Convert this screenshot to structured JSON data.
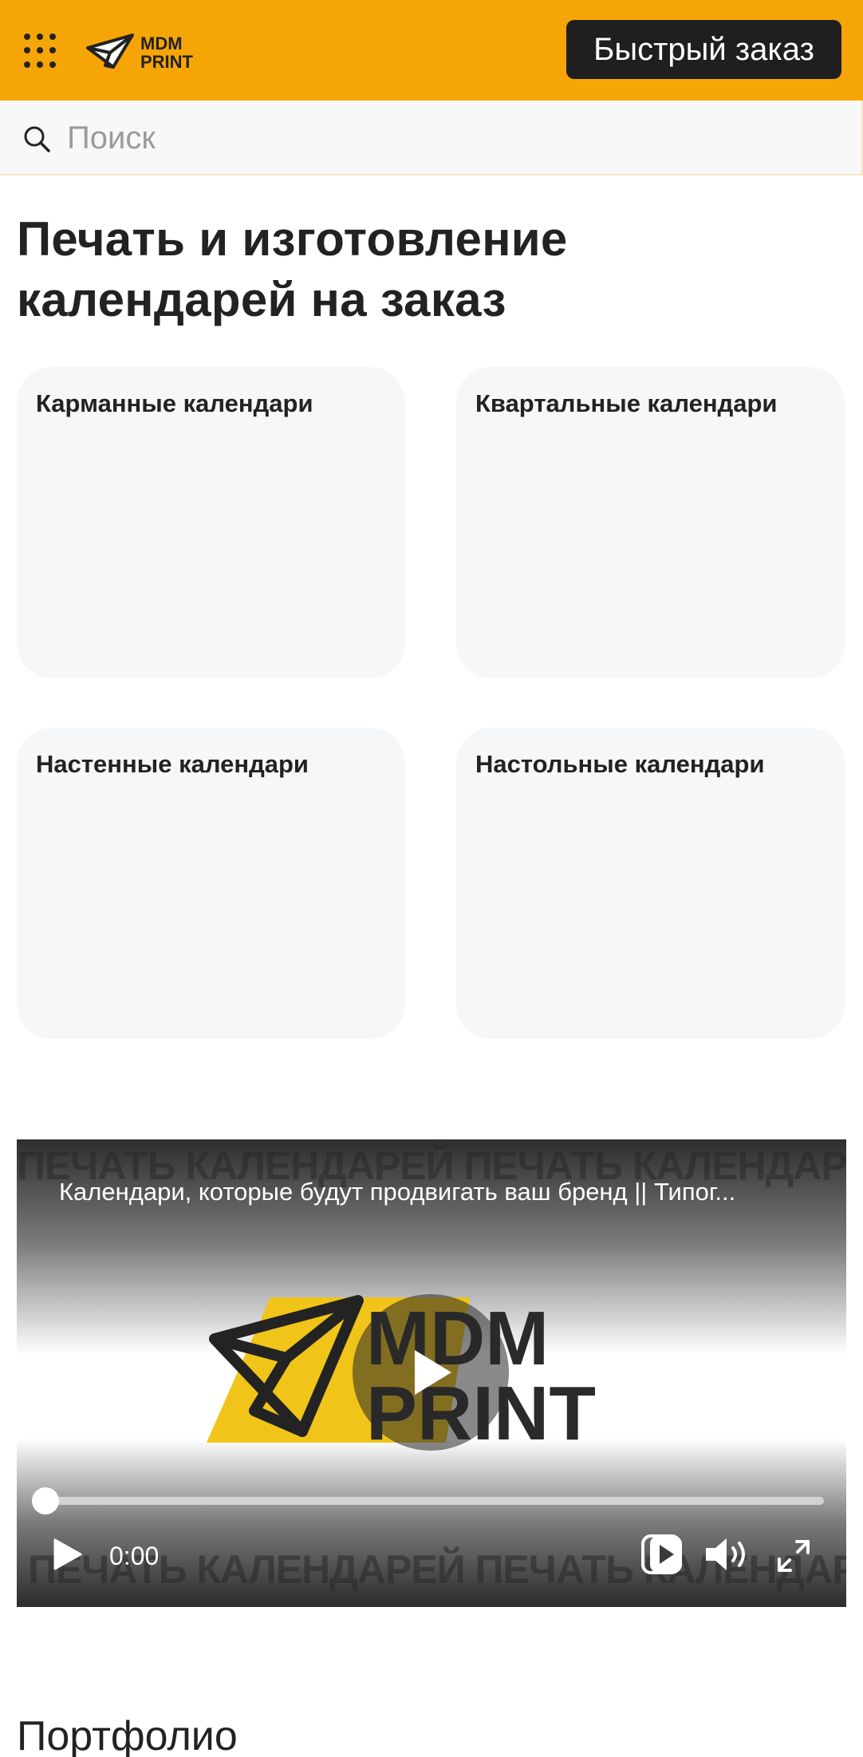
{
  "header": {
    "logo_text": [
      "MDM",
      "PRINT"
    ],
    "quick_order_label": "Быстрый заказ",
    "brand_color": "#f6a507"
  },
  "search": {
    "placeholder": "Поиск",
    "value": ""
  },
  "page": {
    "title_line1": "Печать и изготовление",
    "title_line2": "календарей на заказ"
  },
  "categories": [
    {
      "label": "Карманные календари"
    },
    {
      "label": "Квартальные календари"
    },
    {
      "label": "Настенные календари"
    },
    {
      "label": "Настольные календари"
    }
  ],
  "video": {
    "title": "Календари, которые будут продвигать ваш бренд || Типог...",
    "watermark": "ПЕЧАТЬ КАЛЕНДАРЕЙ  ПЕЧАТЬ КАЛЕНДАРЕЙ  ПЕЧАТЬ КАЛЕНДАРЕЙ",
    "logo_text": [
      "MDM",
      "PRINT"
    ],
    "current_time": "0:00",
    "progress": 0,
    "icons": [
      "play-icon",
      "picture-in-picture-icon",
      "volume-icon",
      "fullscreen-icon"
    ]
  },
  "sections": {
    "portfolio_heading": "Портфолио"
  }
}
